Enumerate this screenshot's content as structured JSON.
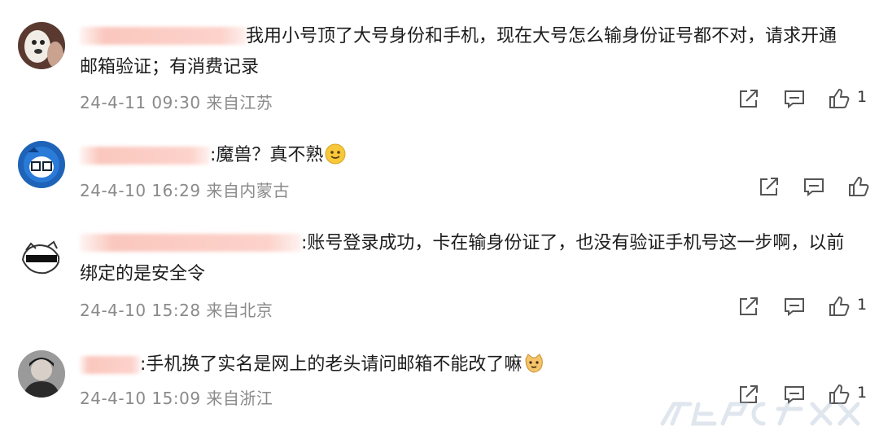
{
  "comments": [
    {
      "text_line1": "我用小号顶了大号身份和手机，现在大号怎么输身份证号都不对，请求开通",
      "text_line2": "邮箱验证；有消费记录",
      "meta": "24-4-11 09:30 来自江苏",
      "likes": "1"
    },
    {
      "text_line1": ":魔兽？真不熟",
      "text_line2": "",
      "meta": "24-4-10 16:29 来自内蒙古",
      "likes": ""
    },
    {
      "text_line1": ":账号登录成功，卡在输身份证了，也没有验证手机号这一步啊，以前",
      "text_line2": "绑定的是安全令",
      "meta": "24-4-10 15:28 来自北京",
      "likes": "1"
    },
    {
      "text_line1": ":手机换了实名是网上的老头请问邮箱不能改了嘛",
      "text_line2": "",
      "meta": "24-4-10 15:09 来自浙江",
      "likes": "1"
    }
  ],
  "icons": {
    "share": "share-icon",
    "comment": "comment-icon",
    "like": "thumbs-up-icon"
  },
  "colors": {
    "text": "#1c1c1c",
    "meta": "#8a8a8a",
    "icon": "#555555"
  }
}
